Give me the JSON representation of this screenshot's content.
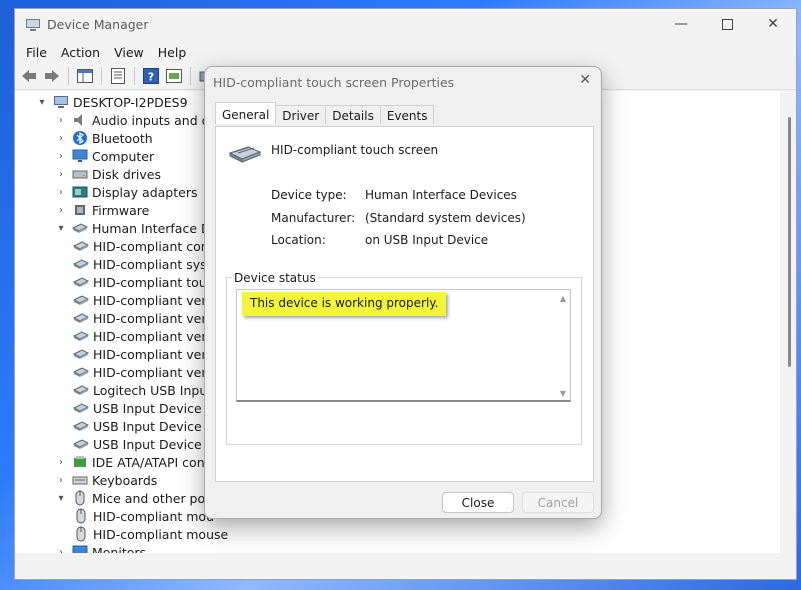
{
  "window": {
    "title": "Device Manager"
  },
  "menu": [
    "File",
    "Action",
    "View",
    "Help"
  ],
  "tree": [
    {
      "label": "DESKTOP-I2PDES9",
      "exp": "▾",
      "icon": "computer-icon",
      "depth": 0
    },
    {
      "label": "Audio inputs and outpu",
      "exp": "›",
      "icon": "speaker-icon",
      "depth": 1
    },
    {
      "label": "Bluetooth",
      "exp": "›",
      "icon": "bluetooth-icon",
      "depth": 1
    },
    {
      "label": "Computer",
      "exp": "›",
      "icon": "monitor-icon",
      "depth": 1
    },
    {
      "label": "Disk drives",
      "exp": "›",
      "icon": "disk-icon",
      "depth": 1
    },
    {
      "label": "Display adapters",
      "exp": "›",
      "icon": "display-adapter-icon",
      "depth": 1
    },
    {
      "label": "Firmware",
      "exp": "›",
      "icon": "chip-icon",
      "depth": 1
    },
    {
      "label": "Human Interface Device",
      "exp": "▾",
      "icon": "hid-icon",
      "depth": 1
    },
    {
      "label": "HID-compliant cons",
      "exp": "",
      "icon": "hid-icon",
      "depth": 2
    },
    {
      "label": "HID-compliant syste",
      "exp": "",
      "icon": "hid-icon",
      "depth": 2
    },
    {
      "label": "HID-compliant touc",
      "exp": "",
      "icon": "hid-icon",
      "depth": 2
    },
    {
      "label": "HID-compliant vend",
      "exp": "",
      "icon": "hid-icon",
      "depth": 2
    },
    {
      "label": "HID-compliant vend",
      "exp": "",
      "icon": "hid-icon",
      "depth": 2
    },
    {
      "label": "HID-compliant vend",
      "exp": "",
      "icon": "hid-icon",
      "depth": 2
    },
    {
      "label": "HID-compliant vend",
      "exp": "",
      "icon": "hid-icon",
      "depth": 2
    },
    {
      "label": "HID-compliant vend",
      "exp": "",
      "icon": "hid-icon",
      "depth": 2
    },
    {
      "label": "Logitech USB Input I",
      "exp": "",
      "icon": "hid-icon",
      "depth": 2
    },
    {
      "label": "USB Input Device",
      "exp": "",
      "icon": "hid-icon",
      "depth": 2
    },
    {
      "label": "USB Input Device",
      "exp": "",
      "icon": "hid-icon",
      "depth": 2
    },
    {
      "label": "USB Input Device",
      "exp": "",
      "icon": "hid-icon",
      "depth": 2
    },
    {
      "label": "IDE ATA/ATAPI controlle",
      "exp": "›",
      "icon": "ide-icon",
      "depth": 1
    },
    {
      "label": "Keyboards",
      "exp": "›",
      "icon": "keyboard-icon",
      "depth": 1
    },
    {
      "label": "Mice and other pointing",
      "exp": "▾",
      "icon": "mouse-icon",
      "depth": 1
    },
    {
      "label": "HID-compliant mou",
      "exp": "",
      "icon": "mouse-icon",
      "depth": 2
    },
    {
      "label": "HID-compliant mouse",
      "exp": "",
      "icon": "mouse-icon",
      "depth": 2
    },
    {
      "label": "Monitors",
      "exp": "›",
      "icon": "monitor-icon",
      "depth": 1
    }
  ],
  "dialog": {
    "title": "HID-compliant touch screen Properties",
    "tabs": [
      "General",
      "Driver",
      "Details",
      "Events"
    ],
    "device_name": "HID-compliant touch screen",
    "props": [
      {
        "label": "Device type:",
        "value": "Human Interface Devices"
      },
      {
        "label": "Manufacturer:",
        "value": "(Standard system devices)"
      },
      {
        "label": "Location:",
        "value": "on USB Input Device"
      }
    ],
    "status_group": "Device status",
    "status_text": "This device is working properly.",
    "close_label": "Close",
    "cancel_label": "Cancel"
  }
}
